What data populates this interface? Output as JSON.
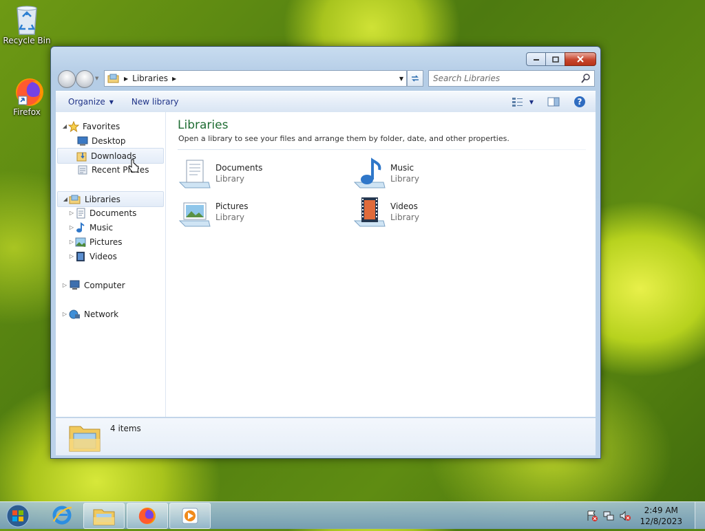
{
  "desktop": {
    "icons": [
      {
        "label": "Recycle Bin"
      },
      {
        "label": "Firefox"
      }
    ]
  },
  "window": {
    "address": {
      "crumb": "Libraries"
    },
    "search": {
      "placeholder": "Search Libraries"
    },
    "toolbar": {
      "organize_label": "Organize",
      "new_library_label": "New library"
    },
    "nav": {
      "favorites_label": "Favorites",
      "favorites": [
        {
          "label": "Desktop"
        },
        {
          "label": "Downloads"
        },
        {
          "label": "Recent Places"
        }
      ],
      "libraries_label": "Libraries",
      "libraries": [
        {
          "label": "Documents"
        },
        {
          "label": "Music"
        },
        {
          "label": "Pictures"
        },
        {
          "label": "Videos"
        }
      ],
      "computer_label": "Computer",
      "network_label": "Network"
    },
    "content": {
      "title": "Libraries",
      "description": "Open a library to see your files and arrange them by folder, date, and other properties.",
      "items": [
        {
          "name": "Documents",
          "type": "Library"
        },
        {
          "name": "Music",
          "type": "Library"
        },
        {
          "name": "Pictures",
          "type": "Library"
        },
        {
          "name": "Videos",
          "type": "Library"
        }
      ]
    },
    "details": {
      "count": "4 items"
    }
  },
  "taskbar": {
    "clock_time": "2:49 AM",
    "clock_date": "12/8/2023"
  }
}
